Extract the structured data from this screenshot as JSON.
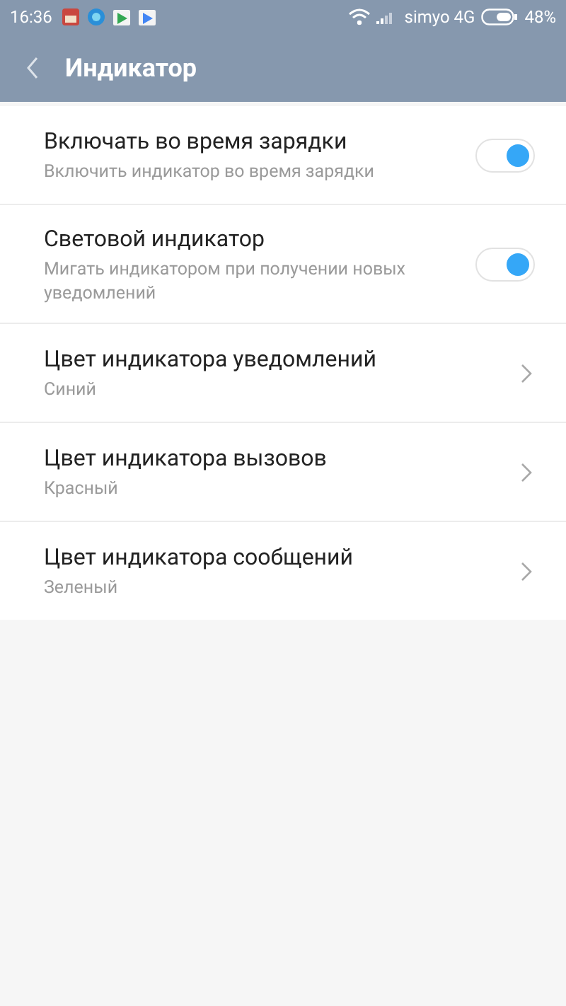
{
  "status_bar": {
    "time": "16:36",
    "carrier": "simyo 4G",
    "battery": "48%"
  },
  "header": {
    "title": "Индикатор"
  },
  "items": [
    {
      "kind": "toggle",
      "title": "Включать во время зарядки",
      "subtitle": "Включить индикатор во время зарядки",
      "on": true
    },
    {
      "kind": "toggle",
      "title": "Световой индикатор",
      "subtitle": "Мигать индикатором при получении новых уведомлений",
      "on": true
    },
    {
      "kind": "link",
      "title": "Цвет индикатора уведомлений",
      "subtitle": "Синий"
    },
    {
      "kind": "link",
      "title": "Цвет индикатора вызовов",
      "subtitle": "Красный"
    },
    {
      "kind": "link",
      "title": "Цвет индикатора сообщений",
      "subtitle": "Зеленый"
    }
  ]
}
